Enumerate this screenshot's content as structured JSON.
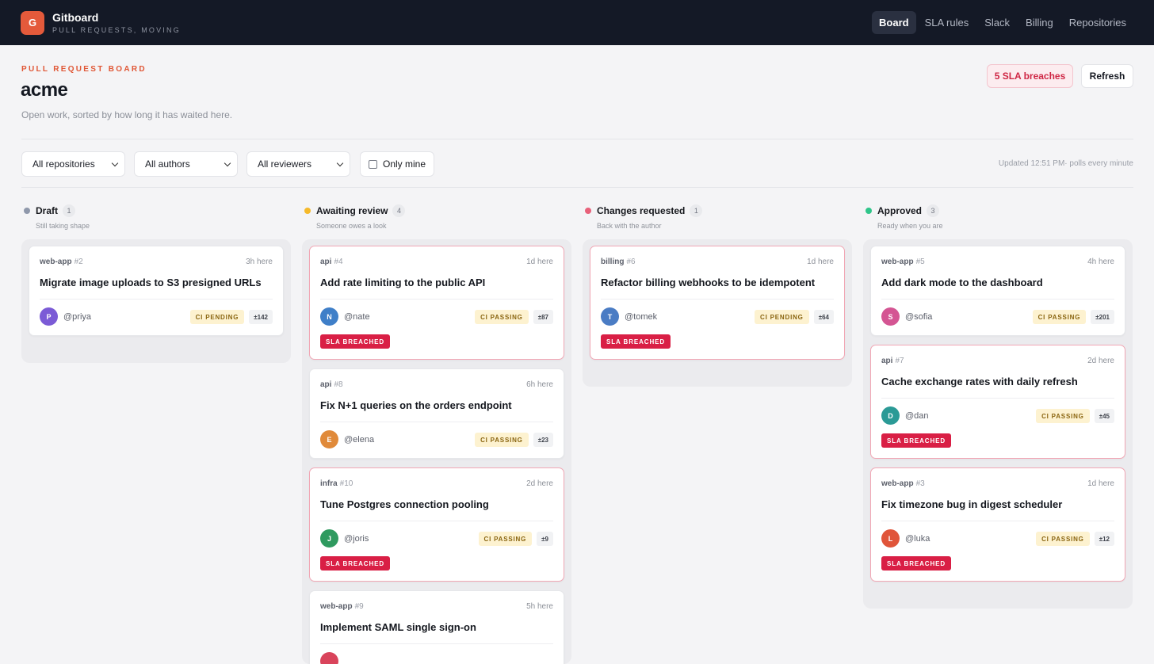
{
  "app": {
    "logo_letter": "G",
    "name": "Gitboard",
    "tagline": "PULL REQUESTS, MOVING"
  },
  "nav": [
    {
      "label": "Board",
      "active": true
    },
    {
      "label": "SLA rules",
      "active": false
    },
    {
      "label": "Slack",
      "active": false
    },
    {
      "label": "Billing",
      "active": false
    },
    {
      "label": "Repositories",
      "active": false
    }
  ],
  "header": {
    "eyebrow": "PULL REQUEST BOARD",
    "org": "acme",
    "subtitle": "Open work, sorted by how long it has waited here.",
    "breach_label": "5 SLA breaches",
    "refresh_label": "Refresh"
  },
  "filters": {
    "repositories": "All repositories",
    "authors": "All authors",
    "reviewers": "All reviewers",
    "only_mine": "Only mine",
    "only_mine_checked": false,
    "updated": "Updated 12:51 PM· polls every minute"
  },
  "columns": [
    {
      "title": "Draft",
      "count": "1",
      "subtitle": "Still taking shape",
      "color": "#8f98ab",
      "cards": [
        {
          "repo": "web-app",
          "num": "#2",
          "age": "3h here",
          "title": "Migrate image uploads to S3 presigned URLs",
          "avatar": "P",
          "avatar_color": "#7b5bd6",
          "author": "@priya",
          "ci": "CI PENDING",
          "diff": "±142",
          "sla": ""
        }
      ]
    },
    {
      "title": "Awaiting review",
      "count": "4",
      "subtitle": "Someone owes a look",
      "color": "#f5b92a",
      "cards": [
        {
          "repo": "api",
          "num": "#4",
          "age": "1d here",
          "title": "Add rate limiting to the public API",
          "avatar": "N",
          "avatar_color": "#3f7fc8",
          "author": "@nate",
          "ci": "CI PASSING",
          "diff": "±87",
          "sla": "SLA BREACHED"
        },
        {
          "repo": "api",
          "num": "#8",
          "age": "6h here",
          "title": "Fix N+1 queries on the orders endpoint",
          "avatar": "E",
          "avatar_color": "#e08a3a",
          "author": "@elena",
          "ci": "CI PASSING",
          "diff": "±23",
          "sla": ""
        },
        {
          "repo": "infra",
          "num": "#10",
          "age": "2d here",
          "title": "Tune Postgres connection pooling",
          "avatar": "J",
          "avatar_color": "#2f9a5f",
          "author": "@joris",
          "ci": "CI PASSING",
          "diff": "±9",
          "sla": "SLA BREACHED"
        },
        {
          "repo": "web-app",
          "num": "#9",
          "age": "5h here",
          "title": "Implement SAML single sign-on",
          "avatar": "",
          "avatar_color": "#d9445b",
          "author": "",
          "ci": "",
          "diff": "",
          "sla": ""
        }
      ]
    },
    {
      "title": "Changes requested",
      "count": "1",
      "subtitle": "Back with the author",
      "color": "#e8617a",
      "cards": [
        {
          "repo": "billing",
          "num": "#6",
          "age": "1d here",
          "title": "Refactor billing webhooks to be idempotent",
          "avatar": "T",
          "avatar_color": "#4a7cc4",
          "author": "@tomek",
          "ci": "CI PENDING",
          "diff": "±64",
          "sla": "SLA BREACHED"
        }
      ]
    },
    {
      "title": "Approved",
      "count": "3",
      "subtitle": "Ready when you are",
      "color": "#2fc58a",
      "cards": [
        {
          "repo": "web-app",
          "num": "#5",
          "age": "4h here",
          "title": "Add dark mode to the dashboard",
          "avatar": "S",
          "avatar_color": "#d45593",
          "author": "@sofia",
          "ci": "CI PASSING",
          "diff": "±201",
          "sla": ""
        },
        {
          "repo": "api",
          "num": "#7",
          "age": "2d here",
          "title": "Cache exchange rates with daily refresh",
          "avatar": "D",
          "avatar_color": "#2b9a96",
          "author": "@dan",
          "ci": "CI PASSING",
          "diff": "±45",
          "sla": "SLA BREACHED"
        },
        {
          "repo": "web-app",
          "num": "#3",
          "age": "1d here",
          "title": "Fix timezone bug in digest scheduler",
          "avatar": "L",
          "avatar_color": "#e0553a",
          "author": "@luka",
          "ci": "CI PASSING",
          "diff": "±12",
          "sla": "SLA BREACHED"
        }
      ]
    }
  ]
}
